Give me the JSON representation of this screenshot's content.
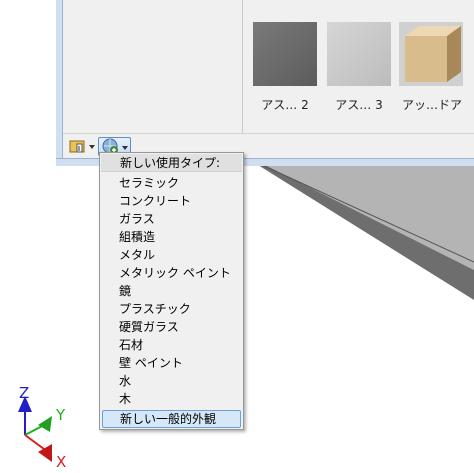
{
  "materials": {
    "thumbnails": [
      {
        "label": "アス… 2",
        "kind": "asphalt-dark"
      },
      {
        "label": "アス… 3",
        "kind": "asphalt-light"
      },
      {
        "label": "アッ…ドア",
        "kind": "wood-cube"
      }
    ]
  },
  "toolbar": {
    "library_button_icon": "library-book-icon",
    "new_material_button_icon": "globe-add-icon"
  },
  "menu": {
    "header": "新しい使用タイプ:",
    "items": [
      "セラミック",
      "コンクリート",
      "ガラス",
      "組積造",
      "メタル",
      "メタリック ペイント",
      "鏡",
      "プラスチック",
      "硬質ガラス",
      "石材",
      "壁 ペイント",
      "水",
      "木"
    ],
    "footer": "新しい一般的外観"
  },
  "axis": {
    "x_label": "X",
    "y_label": "Y",
    "z_label": "Z",
    "x_color": "#d42020",
    "y_color": "#20b020",
    "z_color": "#2020c8"
  }
}
